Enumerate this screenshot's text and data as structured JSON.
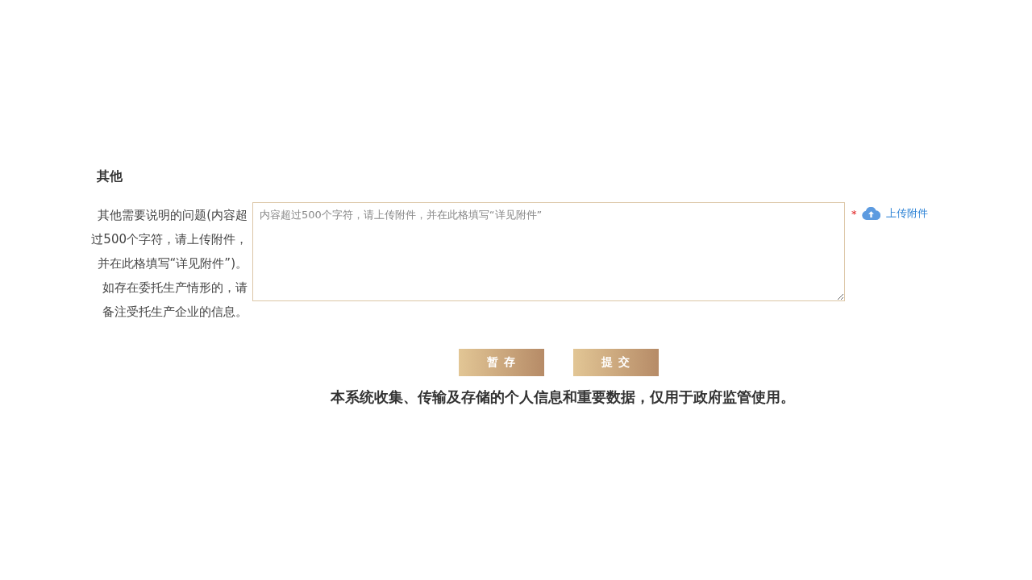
{
  "section": {
    "title": "其他"
  },
  "field": {
    "label": "其他需要说明的问题(内容超过500个字符，请上传附件，并在此格填写“详见附件”)。如存在委托生产情形的，请备注受托生产企业的信息。",
    "placeholder": "内容超过500个字符，请上传附件，并在此格填写“详见附件”",
    "required_mark": "*",
    "upload": {
      "label": "上传附件"
    }
  },
  "buttons": [
    {
      "label": "暂 存"
    },
    {
      "label": "提 交"
    }
  ],
  "notice": "本系统收集、传输及存储的个人信息和重要数据，仅用于政府监管使用。"
}
